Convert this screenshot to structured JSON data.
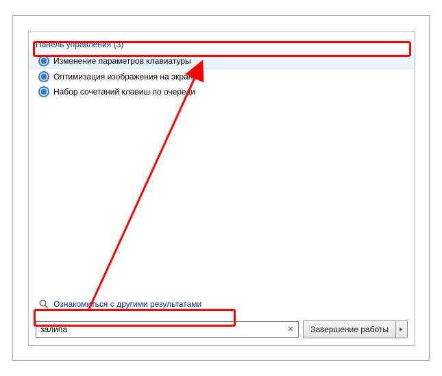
{
  "category": {
    "label": "Панель управления (3)"
  },
  "results": [
    {
      "label": "Изменение параметров клавиатуры",
      "highlighted": true
    },
    {
      "label": "Оптимизация изображения на экране",
      "highlighted": false
    },
    {
      "label": "Набор сочетаний клавиш по очереди",
      "highlighted": false
    }
  ],
  "more_results_label": "Ознакомиться с другими результатами",
  "search": {
    "value": "залипа"
  },
  "shutdown": {
    "label": "Завершение работы"
  }
}
